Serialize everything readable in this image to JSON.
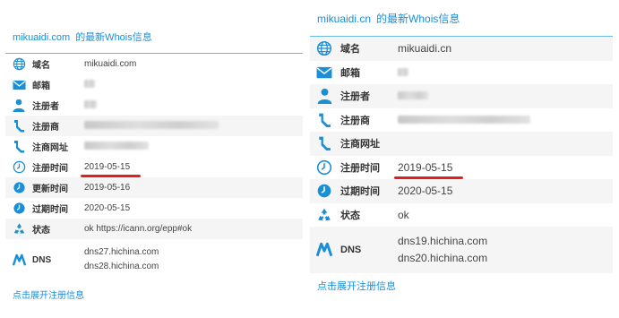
{
  "left": {
    "title_domain": "mikuaidi.com",
    "title_suffix": "的最新Whois信息",
    "rows": [
      {
        "icon": "globe-icon",
        "label": "域名",
        "value": "mikuaidi.com"
      },
      {
        "icon": "mail-icon",
        "label": "邮箱",
        "value": ""
      },
      {
        "icon": "user-icon",
        "label": "注册者",
        "value": ""
      },
      {
        "icon": "registrar-icon",
        "label": "注册商",
        "value": ""
      },
      {
        "icon": "registrar-url-icon",
        "label": "注商网址",
        "value": ""
      },
      {
        "icon": "clock-icon",
        "label": "注册时间",
        "value": "2019-05-15"
      },
      {
        "icon": "clock-icon",
        "label": "更新时间",
        "value": "2019-05-16"
      },
      {
        "icon": "clock-icon",
        "label": "过期时间",
        "value": "2020-05-15"
      },
      {
        "icon": "recycle-icon",
        "label": "状态",
        "value": "ok https://icann.org/epp#ok"
      },
      {
        "icon": "dns-icon",
        "label": "DNS",
        "values": [
          "dns27.hichina.com",
          "dns28.hichina.com"
        ]
      }
    ],
    "expand_link": "点击展开注册信息"
  },
  "right": {
    "title_domain": "mikuaidi.cn",
    "title_suffix": "的最新Whois信息",
    "rows": [
      {
        "icon": "globe-icon",
        "label": "域名",
        "value": "mikuaidi.cn"
      },
      {
        "icon": "mail-icon",
        "label": "邮箱",
        "value": ""
      },
      {
        "icon": "user-icon",
        "label": "注册者",
        "value": ""
      },
      {
        "icon": "registrar-icon",
        "label": "注册商",
        "value": ""
      },
      {
        "icon": "registrar-url-icon",
        "label": "注商网址",
        "value": ""
      },
      {
        "icon": "clock-icon",
        "label": "注册时间",
        "value": "2019-05-15"
      },
      {
        "icon": "clock-icon",
        "label": "过期时间",
        "value": "2020-05-15"
      },
      {
        "icon": "recycle-icon",
        "label": "状态",
        "value": "ok"
      },
      {
        "icon": "dns-icon",
        "label": "DNS",
        "values": [
          "dns19.hichina.com",
          "dns20.hichina.com"
        ]
      }
    ],
    "expand_link": "点击展开注册信息"
  },
  "colors": {
    "accent": "#1a8fd6",
    "highlight_underline": "#e02020",
    "alt_row": "#f5f5f5"
  }
}
